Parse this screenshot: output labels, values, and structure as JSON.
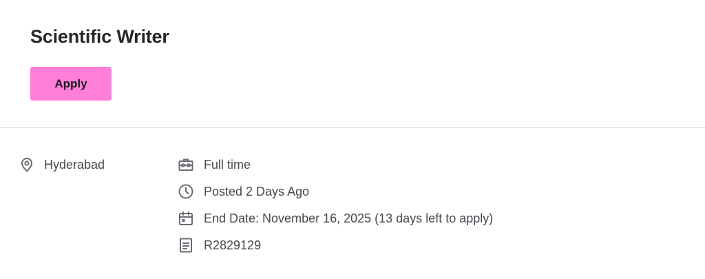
{
  "job": {
    "title": "Scientific Writer",
    "apply_label": "Apply",
    "accent_color": "#ff7ed8"
  },
  "details": {
    "location": {
      "icon": "location-pin-icon",
      "text": "Hyderabad"
    },
    "items": [
      {
        "icon": "briefcase-icon",
        "text": "Full time"
      },
      {
        "icon": "clock-icon",
        "text": "Posted 2 Days Ago"
      },
      {
        "icon": "calendar-icon",
        "text": "End Date: November 16, 2025 (13 days left to apply)"
      },
      {
        "icon": "document-icon",
        "text": "R2829129"
      }
    ]
  }
}
